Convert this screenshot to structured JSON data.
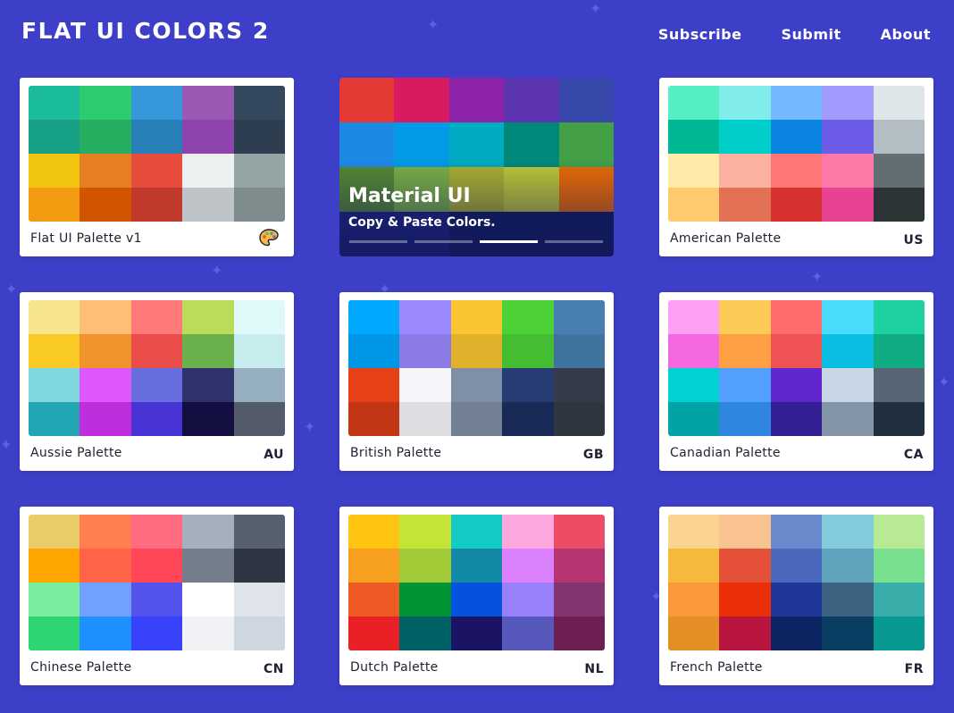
{
  "header": {
    "title": "FLAT UI COLORS 2",
    "nav": [
      "Subscribe",
      "Submit",
      "About"
    ]
  },
  "featured": {
    "title": "Material UI",
    "subtitle": "Copy & Paste Colors.",
    "active_slide": 2,
    "slides": 4,
    "colors": [
      "#e53935",
      "#d81b60",
      "#8e24aa",
      "#5e35b1",
      "#3949ab",
      "#1e88e5",
      "#039be5",
      "#00acc1",
      "#00897b",
      "#43a047",
      "#558b2f",
      "#7cb342",
      "#afb42b",
      "#c0ca33",
      "#ef6c00",
      "#1a237e",
      "#1a237e",
      "#0d1b5e",
      "#0d1b5e",
      "#0d1b5e"
    ]
  },
  "palettes": [
    {
      "name": "Flat UI Palette v1",
      "code": "",
      "icon": "artist-palette-icon",
      "colors": [
        "#1abc9c",
        "#2ecc71",
        "#3498db",
        "#9b59b6",
        "#34495e",
        "#16a085",
        "#27ae60",
        "#2980b9",
        "#8e44ad",
        "#2c3e50",
        "#f1c40f",
        "#e67e22",
        "#e74c3c",
        "#ecf0f1",
        "#95a5a6",
        "#f39c12",
        "#d35400",
        "#c0392b",
        "#bdc3c7",
        "#7f8c8d"
      ]
    },
    {
      "name": "American Palette",
      "code": "US",
      "colors": [
        "#55efc4",
        "#81ecec",
        "#74b9ff",
        "#a29bfe",
        "#dfe6e9",
        "#00b894",
        "#00cec9",
        "#0984e3",
        "#6c5ce7",
        "#b2bec3",
        "#ffeaa7",
        "#fab1a0",
        "#ff7675",
        "#fd79a8",
        "#636e72",
        "#fdcb6e",
        "#e17055",
        "#d63031",
        "#e84393",
        "#2d3436"
      ]
    },
    {
      "name": "Aussie Palette",
      "code": "AU",
      "colors": [
        "#f6e58d",
        "#ffbe76",
        "#ff7979",
        "#badc58",
        "#dff9fb",
        "#f9ca24",
        "#f0932b",
        "#eb4d4b",
        "#6ab04c",
        "#c7ecee",
        "#7ed6df",
        "#e056fd",
        "#686de0",
        "#30336b",
        "#95afc0",
        "#22a6b3",
        "#be2edd",
        "#4834d4",
        "#130f40",
        "#535c68"
      ]
    },
    {
      "name": "British Palette",
      "code": "GB",
      "colors": [
        "#00a8ff",
        "#9c88ff",
        "#fbc531",
        "#4cd137",
        "#487eb0",
        "#0097e6",
        "#8c7ae6",
        "#e1b12c",
        "#44bd32",
        "#40739e",
        "#e84118",
        "#f5f6fa",
        "#7f8fa6",
        "#273c75",
        "#353b48",
        "#c23616",
        "#dcdde1",
        "#718093",
        "#192a56",
        "#2f3640"
      ]
    },
    {
      "name": "Canadian Palette",
      "code": "CA",
      "colors": [
        "#ff9ff3",
        "#feca57",
        "#ff6b6b",
        "#48dbfb",
        "#1dd1a1",
        "#f368e0",
        "#ff9f43",
        "#ee5253",
        "#0abde3",
        "#10ac84",
        "#00d2d3",
        "#54a0ff",
        "#5f27cd",
        "#c8d6e5",
        "#576574",
        "#01a3a4",
        "#2e86de",
        "#341f97",
        "#8395a7",
        "#222f3e"
      ]
    },
    {
      "name": "Chinese Palette",
      "code": "CN",
      "colors": [
        "#eccc68",
        "#ff7f50",
        "#ff6b81",
        "#a4b0be",
        "#57606f",
        "#ffa502",
        "#ff6348",
        "#ff4757",
        "#747d8c",
        "#2f3542",
        "#7bed9f",
        "#70a1ff",
        "#5352ed",
        "#ffffff",
        "#dfe4ea",
        "#2ed573",
        "#1e90ff",
        "#3742fa",
        "#f1f2f6",
        "#ced6e0"
      ]
    },
    {
      "name": "Dutch Palette",
      "code": "NL",
      "colors": [
        "#ffc312",
        "#c4e538",
        "#12cbc4",
        "#fda7df",
        "#ed4c67",
        "#f79f1f",
        "#a3cb38",
        "#1289a7",
        "#d980fa",
        "#b53471",
        "#ee5a24",
        "#009432",
        "#0652dd",
        "#9980fa",
        "#833471",
        "#ea2027",
        "#006266",
        "#1b1464",
        "#5758bb",
        "#6f1e51"
      ]
    },
    {
      "name": "French Palette",
      "code": "FR",
      "colors": [
        "#fad390",
        "#f8c291",
        "#6a89cc",
        "#82ccdd",
        "#b8e994",
        "#f6b93b",
        "#e55039",
        "#4a69bd",
        "#60a3bc",
        "#78e08f",
        "#fa983a",
        "#eb2f06",
        "#1e3799",
        "#3c6382",
        "#38ada9",
        "#e58e26",
        "#b71540",
        "#0c2461",
        "#0a3d62",
        "#079992"
      ]
    }
  ]
}
